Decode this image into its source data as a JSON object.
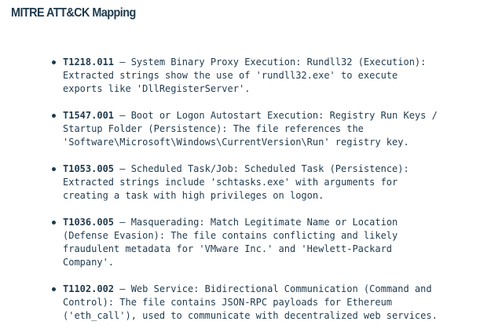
{
  "page": {
    "heading": "MITRE ATT&CK Mapping"
  },
  "techniques": [
    {
      "id": "T1218.011",
      "lines": [
        " — System Binary Proxy Execution: Rundll32 (Execution):",
        "Extracted strings show the use of 'rundll32.exe' to execute",
        "exports like 'DllRegisterServer'."
      ]
    },
    {
      "id": "T1547.001",
      "lines": [
        " — Boot or Logon Autostart Execution: Registry Run Keys /",
        "Startup Folder (Persistence): The file references the",
        "'Software\\Microsoft\\Windows\\CurrentVersion\\Run' registry key."
      ]
    },
    {
      "id": "T1053.005",
      "lines": [
        " — Scheduled Task/Job: Scheduled Task (Persistence):",
        "Extracted strings include 'schtasks.exe' with arguments for",
        "creating a task with high privileges on logon."
      ]
    },
    {
      "id": "T1036.005",
      "lines": [
        " — Masquerading: Match Legitimate Name or Location",
        "(Defense Evasion): The file contains conflicting and likely",
        "fraudulent metadata for 'VMware Inc.' and 'Hewlett-Packard",
        "Company'."
      ]
    },
    {
      "id": "T1102.002",
      "lines": [
        " — Web Service: Bidirectional Communication (Command and",
        "Control): The file contains JSON-RPC payloads for Ethereum",
        "('eth_call'), used to communicate with decentralized web services."
      ]
    }
  ]
}
